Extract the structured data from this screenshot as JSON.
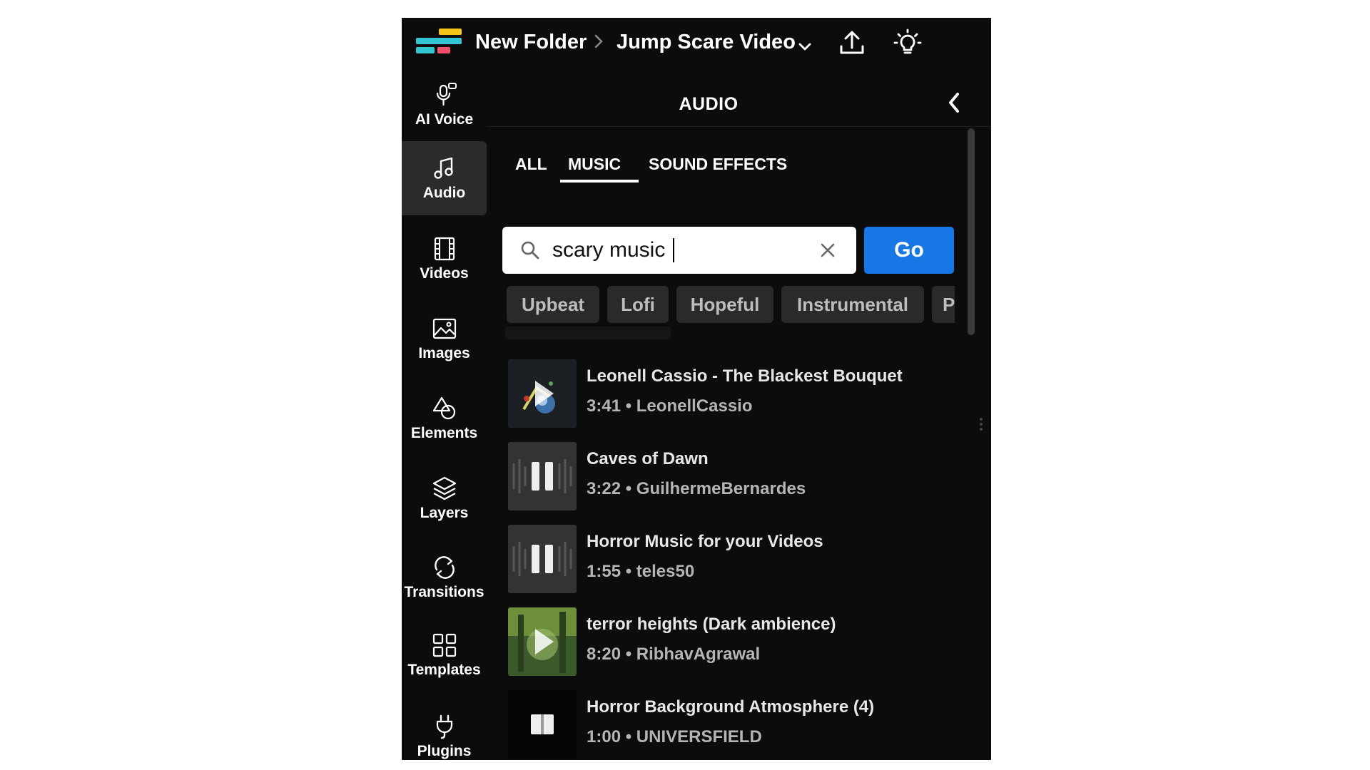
{
  "breadcrumb": {
    "folder": "New Folder",
    "project": "Jump Scare Video"
  },
  "colors": {
    "accent": "#1677e5",
    "background": "#0c0c0c",
    "nav_active": "#2b2b2b",
    "chip": "#2a2a2a"
  },
  "sidebar": {
    "items": [
      {
        "label": "AI Voice",
        "icon": "microphone-icon",
        "active": false
      },
      {
        "label": "Audio",
        "icon": "music-note-icon",
        "active": true
      },
      {
        "label": "Videos",
        "icon": "film-icon",
        "active": false
      },
      {
        "label": "Images",
        "icon": "image-icon",
        "active": false
      },
      {
        "label": "Elements",
        "icon": "shapes-icon",
        "active": false
      },
      {
        "label": "Layers",
        "icon": "layers-icon",
        "active": false
      },
      {
        "label": "Transitions",
        "icon": "transition-icon",
        "active": false
      },
      {
        "label": "Templates",
        "icon": "grid-icon",
        "active": false
      },
      {
        "label": "Plugins",
        "icon": "plug-icon",
        "active": false
      }
    ]
  },
  "panel": {
    "title": "AUDIO",
    "tabs": [
      {
        "label": "ALL",
        "active": false
      },
      {
        "label": "MUSIC",
        "active": true
      },
      {
        "label": "SOUND EFFECTS",
        "active": false
      }
    ],
    "search": {
      "value": "scary music",
      "button_label": "Go"
    },
    "chips": [
      "Upbeat",
      "Lofi",
      "Hopeful",
      "Instrumental",
      "P"
    ],
    "tracks": [
      {
        "title": "Leonell Cassio - The Blackest Bouquet",
        "meta": "3:41 • LeonellCassio",
        "state": "paused"
      },
      {
        "title": "Caves of Dawn",
        "meta": "3:22 • GuilhermeBernardes",
        "state": "playing"
      },
      {
        "title": "Horror Music for your Videos",
        "meta": "1:55 • teles50",
        "state": "playing"
      },
      {
        "title": "terror heights (Dark ambience)",
        "meta": "8:20 • RibhavAgrawal",
        "state": "paused"
      },
      {
        "title": "Horror Background Atmosphere (4)",
        "meta": "1:00 • UNIVERSFIELD",
        "state": "loading"
      }
    ]
  }
}
